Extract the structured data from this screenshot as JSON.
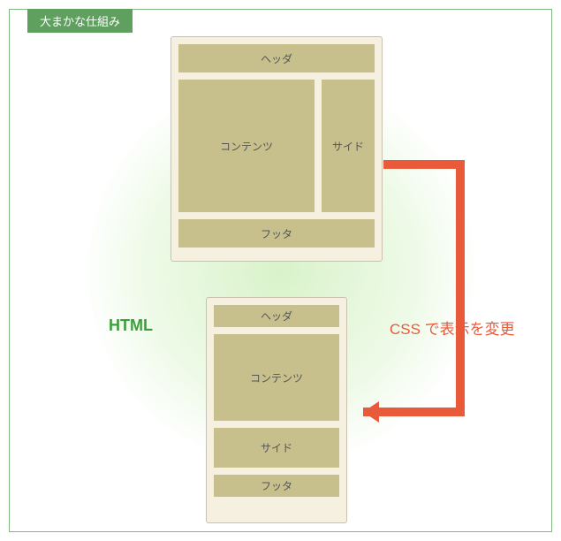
{
  "panel": {
    "title": "大まかな仕組み",
    "html_label": "HTML",
    "css_label": "CSS で表示を変更"
  },
  "layout_top": {
    "header": "ヘッダ",
    "content": "コンテンツ",
    "side": "サイド",
    "footer": "フッタ"
  },
  "layout_bottom": {
    "header": "ヘッダ",
    "content": "コンテンツ",
    "side": "サイド",
    "footer": "フッタ"
  },
  "colors": {
    "accent_green": "#5fa05f",
    "accent_red": "#e85a3a",
    "block_fill": "#c7bf8c",
    "card_bg": "#f5f0df"
  }
}
